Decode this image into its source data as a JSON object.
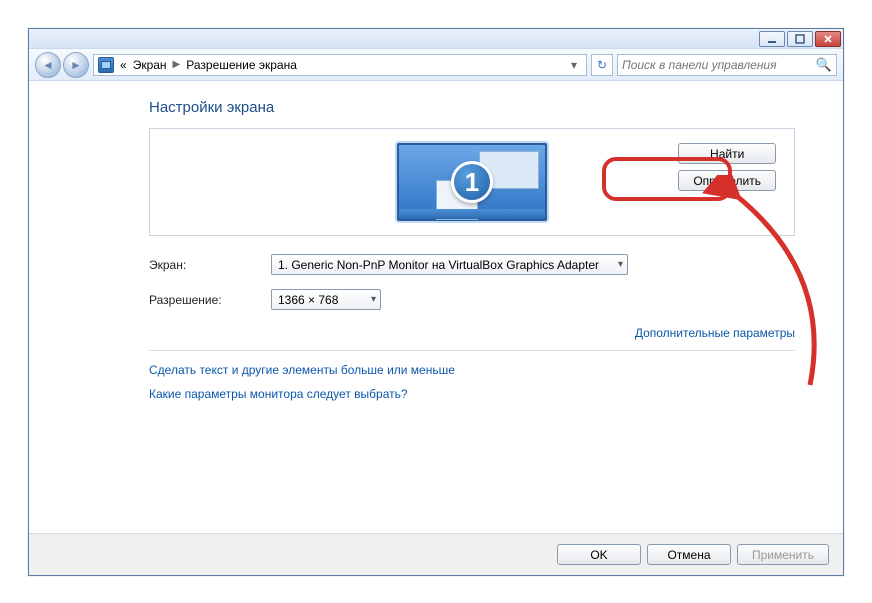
{
  "window": {
    "minimize": "minimize",
    "maximize": "maximize",
    "close": "close"
  },
  "nav": {
    "prefix": "«",
    "crumb1": "Экран",
    "crumb2": "Разрешение экрана"
  },
  "search": {
    "placeholder": "Поиск в панели управления"
  },
  "heading": "Настройки экрана",
  "monitor_number": "1",
  "buttons": {
    "find": "Найти",
    "identify": "Определить"
  },
  "fields": {
    "screen_label": "Экран:",
    "screen_value": "1. Generic Non-PnP Monitor на VirtualBox Graphics Adapter",
    "resolution_label": "Разрешение:",
    "resolution_value": "1366 × 768"
  },
  "links": {
    "advanced": "Дополнительные параметры",
    "bigger_text": "Сделать текст и другие элементы больше или меньше",
    "which_monitor": "Какие параметры монитора следует выбрать?"
  },
  "footer": {
    "ok": "OK",
    "cancel": "Отмена",
    "apply": "Применить"
  }
}
